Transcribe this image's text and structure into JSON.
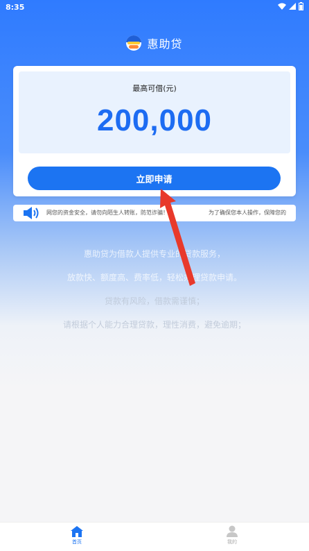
{
  "status_bar": {
    "time": "8:35"
  },
  "header": {
    "title": "惠助贷"
  },
  "loan_card": {
    "limit_label": "最高可借(元)",
    "limit_amount": "200,000",
    "apply_button": "立即申请"
  },
  "notice": {
    "text": "网您的资金安全，请勿向陌生人转账，防范诈骗！",
    "text_2": "为了确保您本人操作，保障您的"
  },
  "info": {
    "lines": [
      "惠助贷为借款人提供专业的贷款服务，",
      "放款快、额度高、费率低，轻松办理贷款申请。",
      "贷款有风险，借款需谨慎；",
      "请根据个人能力合理贷款，理性消费，避免逾期；"
    ]
  },
  "bottom_nav": {
    "items": [
      {
        "label": "首页",
        "icon": "home-icon",
        "active": true
      },
      {
        "label": "我的",
        "icon": "user-icon",
        "active": false
      }
    ]
  },
  "colors": {
    "accent": "#1c74f2",
    "brand_blue": "#2f7bff",
    "arrow": "#e8392b"
  }
}
